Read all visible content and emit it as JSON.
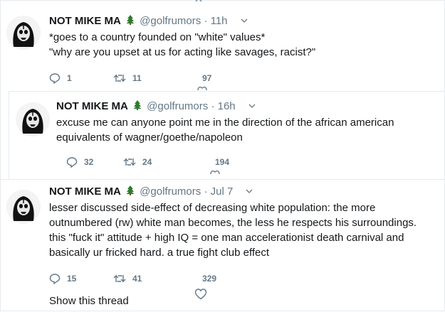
{
  "tweets": [
    {
      "name": "NOT MIKE MA",
      "handle": "@golfrumors",
      "dot": "·",
      "time": "11h",
      "lines": [
        "*goes to a country founded on \"white\" values*",
        "\"why are you upset at us for acting like savages, racist?\""
      ],
      "replies": "1",
      "retweets": "11",
      "likes": "97"
    },
    {
      "name": "NOT MIKE MA",
      "handle": "@golfrumors",
      "dot": "·",
      "time": "16h",
      "lines": [
        "excuse me can anyone point me in the direction of the african american",
        "equivalents of wagner/goethe/napoleon"
      ],
      "replies": "32",
      "retweets": "24",
      "likes": "194"
    },
    {
      "name": "NOT MIKE MA",
      "handle": "@golfrumors",
      "dot": "·",
      "time": "Jul 7",
      "lines": [
        "lesser discussed side-effect of decreasing white population: the more",
        "outnumbered (rw) white man becomes, the less he respects his surroundings.",
        "this \"fuck it\" attitude + high IQ = one man accelerationist death carnival and",
        "basically ur fricked hard. a true fight club effect"
      ],
      "replies": "15",
      "retweets": "41",
      "likes": "329",
      "show_thread": "Show this thread"
    }
  ],
  "colors": {
    "text": "#14171a",
    "muted": "#657786",
    "divider": "#e6ecf0",
    "tree": "#2d7a2d"
  },
  "icons": [
    "avatar-skull",
    "tree-emoji",
    "caret-down-icon",
    "reply-icon",
    "retweet-icon",
    "heart-icon"
  ]
}
